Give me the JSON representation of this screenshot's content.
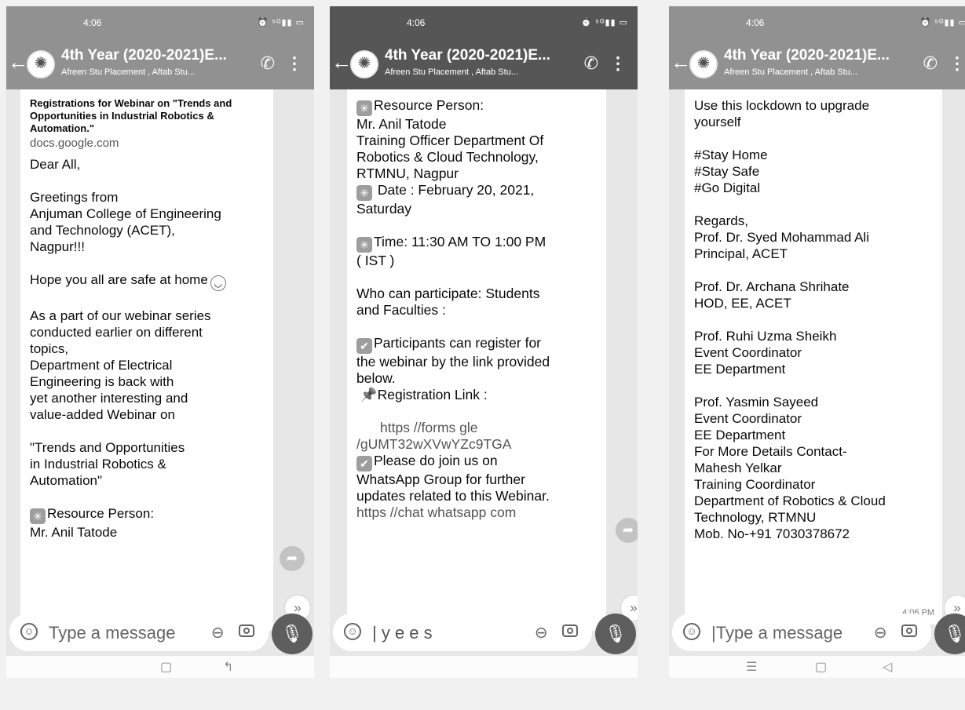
{
  "chat": {
    "time": "4:06",
    "status_icons": "⏰ ⁵ᴳ▮▮ ▭",
    "title": "4th Year (2020-2021)E...",
    "subtitle": "Afreen Stu Placement , Aftab Stu...",
    "input_placeholder": "Type a message"
  },
  "screen1": {
    "preview_title": "Registrations for Webinar on \"Trends and Opportunities in Industrial Robotics & Automation.\"",
    "preview_url": "docs.google.com",
    "greeting": "Dear All,",
    "greetings_line1": "Greetings from",
    "greetings_line2": "Anjuman College of Engineering",
    "greetings_line3": "and Technology (ACET),",
    "greetings_line4": "Nagpur!!!",
    "hope": "Hope you all are safe at home",
    "para1": "As a part of our webinar series",
    "para2": "conducted earlier on different",
    "para3": "topics,",
    "para4": "Department of Electrical",
    "para5": "Engineering is back with",
    "para6": "yet another interesting and",
    "para7": "value-added Webinar on",
    "topic1": " \"Trends and Opportunities",
    "topic2": "in Industrial Robotics &",
    "topic3": "Automation\"",
    "resource_label": "Resource Person:",
    "resource_name": "Mr. Anil Tatode"
  },
  "screen2": {
    "resource_label": "Resource Person:",
    "resource_name": "Mr. Anil Tatode",
    "resource_title1": "Training Officer Department Of",
    "resource_title2": "Robotics & Cloud Technology,",
    "resource_title3": " RTMNU, Nagpur",
    "date1": " Date : February 20, 2021,",
    "date2": "Saturday",
    "time1": "Time: 11:30 AM TO 1:00 PM",
    "time2": "( IST )",
    "who1": "Who can participate: Students",
    "who2": "and Faculties :",
    "reg1": "Participants can register for",
    "reg2": "the webinar by the link provided",
    "reg3": "below.",
    "reg_link_label": "Registration Link :",
    "reg_link1": "https //forms gle",
    "reg_link2": "/gUMT32wXVwYZc9TGA",
    "join1": "Please do join us on",
    "join2": "WhatsApp Group for further",
    "join3": "updates related to this Webinar.",
    "join_link": "https //chat whatsapp com",
    "input_text": "y e   e s"
  },
  "screen3": {
    "l1": "Use this lockdown to upgrade",
    "l2": "yourself",
    "tag1": "#Stay Home",
    "tag2": "#Stay Safe",
    "tag3": "#Go Digital",
    "regards": "Regards,",
    "s1_name": "Prof. Dr. Syed Mohammad Ali",
    "s1_role": "Principal, ACET",
    "s2_name": "Prof. Dr. Archana  Shrihate",
    "s2_role": "HOD, EE, ACET",
    "s3_name": "Prof. Ruhi Uzma Sheikh",
    "s3_role1": "Event Coordinator",
    "s3_role2": "EE Department",
    "s4_name": "Prof. Yasmin Sayeed",
    "s4_role1": "Event Coordinator",
    "s4_role2": "EE Department",
    "contact_label": "For More Details Contact-",
    "c_name": "Mahesh Yelkar",
    "c_role": "Training Coordinator",
    "c_dept1": "Department of Robotics & Cloud",
    "c_dept2": "Technology, RTMNU",
    "c_phone": "Mob. No-+91 7030378672",
    "msg_time": "4:06 PM"
  }
}
